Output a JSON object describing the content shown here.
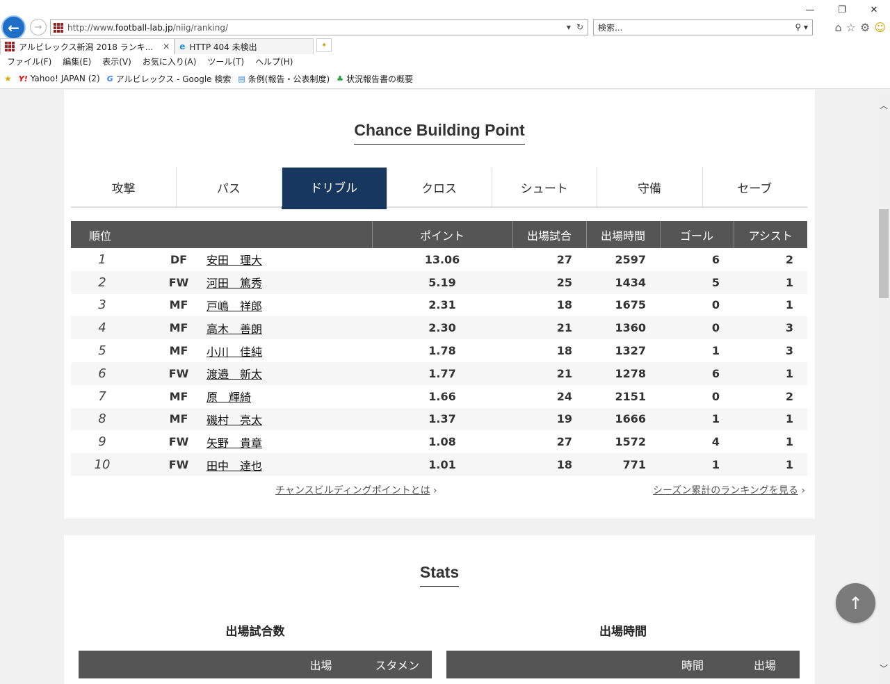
{
  "browser": {
    "url_prefix": "http://www.",
    "url_host": "football-lab.jp",
    "url_path": "/niig/ranking/",
    "search_placeholder": "検索...",
    "tabs": [
      {
        "label": "アルビレックス新潟 2018 ランキ..."
      },
      {
        "label": "HTTP 404 未検出"
      }
    ],
    "menu": [
      "ファイル(F)",
      "編集(E)",
      "表示(V)",
      "お気に入り(A)",
      "ツール(T)",
      "ヘルプ(H)"
    ],
    "favorites": [
      "Yahoo! JAPAN (2)",
      "アルビレックス - Google 検索",
      "条例(報告・公表制度)",
      "状況報告書の概要"
    ]
  },
  "cbp": {
    "title": "Chance Building Point",
    "tabs": [
      "攻撃",
      "パス",
      "ドリブル",
      "クロス",
      "シュート",
      "守備",
      "セーブ"
    ],
    "active_tab": "ドリブル",
    "columns": [
      "順位",
      "ポイント",
      "出場試合",
      "出場時間",
      "ゴール",
      "アシスト"
    ],
    "rows": [
      {
        "rank": "1",
        "pos": "DF",
        "name": "安田　理大",
        "point": "13.06",
        "games": "27",
        "minutes": "2597",
        "goals": "6",
        "assists": "2"
      },
      {
        "rank": "2",
        "pos": "FW",
        "name": "河田　篤秀",
        "point": "5.19",
        "games": "25",
        "minutes": "1434",
        "goals": "5",
        "assists": "1"
      },
      {
        "rank": "3",
        "pos": "MF",
        "name": "戸嶋　祥郎",
        "point": "2.31",
        "games": "18",
        "minutes": "1675",
        "goals": "0",
        "assists": "1"
      },
      {
        "rank": "4",
        "pos": "MF",
        "name": "高木　善朗",
        "point": "2.30",
        "games": "21",
        "minutes": "1360",
        "goals": "0",
        "assists": "3"
      },
      {
        "rank": "5",
        "pos": "MF",
        "name": "小川　佳純",
        "point": "1.78",
        "games": "18",
        "minutes": "1327",
        "goals": "1",
        "assists": "3"
      },
      {
        "rank": "6",
        "pos": "FW",
        "name": "渡邉　新太",
        "point": "1.77",
        "games": "21",
        "minutes": "1278",
        "goals": "6",
        "assists": "1"
      },
      {
        "rank": "7",
        "pos": "MF",
        "name": "原　輝綺",
        "point": "1.66",
        "games": "24",
        "minutes": "2151",
        "goals": "0",
        "assists": "2"
      },
      {
        "rank": "8",
        "pos": "MF",
        "name": "磯村　亮太",
        "point": "1.37",
        "games": "19",
        "minutes": "1666",
        "goals": "1",
        "assists": "1"
      },
      {
        "rank": "9",
        "pos": "FW",
        "name": "矢野　貴章",
        "point": "1.08",
        "games": "27",
        "minutes": "1572",
        "goals": "4",
        "assists": "1"
      },
      {
        "rank": "10",
        "pos": "FW",
        "name": "田中　達也",
        "point": "1.01",
        "games": "18",
        "minutes": "771",
        "goals": "1",
        "assists": "1"
      }
    ],
    "link_about": "チャンスビルディングポイントとは",
    "link_season": "シーズン累計のランキングを見る"
  },
  "stats": {
    "title": "Stats",
    "left_title": "出場試合数",
    "left_cols": [
      "出場",
      "スタメン"
    ],
    "right_title": "出場時間",
    "right_cols": [
      "時間",
      "出場"
    ]
  },
  "colors": {
    "active_tab": "#17375e",
    "table_header": "#555555"
  }
}
